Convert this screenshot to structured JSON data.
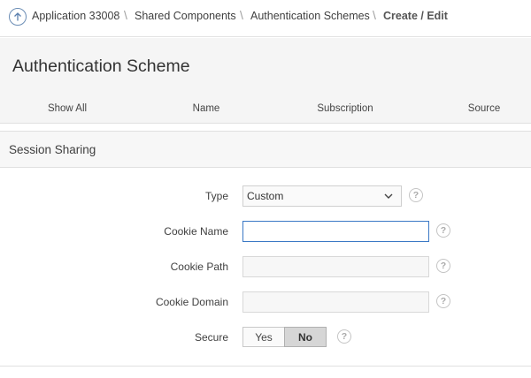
{
  "breadcrumb": {
    "items": [
      {
        "label": "Application 33008"
      },
      {
        "label": "Shared Components"
      },
      {
        "label": "Authentication Schemes"
      },
      {
        "label": "Create / Edit"
      }
    ],
    "separator": "\\"
  },
  "page": {
    "title": "Authentication Scheme"
  },
  "tabs": [
    {
      "label": "Show All"
    },
    {
      "label": "Name"
    },
    {
      "label": "Subscription"
    },
    {
      "label": "Source"
    }
  ],
  "section": {
    "title": "Session Sharing"
  },
  "form": {
    "type": {
      "label": "Type",
      "value": "Custom"
    },
    "cookie_name": {
      "label": "Cookie Name",
      "value": ""
    },
    "cookie_path": {
      "label": "Cookie Path",
      "value": ""
    },
    "cookie_domain": {
      "label": "Cookie Domain",
      "value": ""
    },
    "secure": {
      "label": "Secure",
      "yes_label": "Yes",
      "no_label": "No",
      "selected": "No"
    }
  },
  "help_glyph": "?",
  "colors": {
    "accent": "#3a78c5",
    "header_bg": "#f5f5f5",
    "selected_toggle": "#d6d6d6"
  }
}
